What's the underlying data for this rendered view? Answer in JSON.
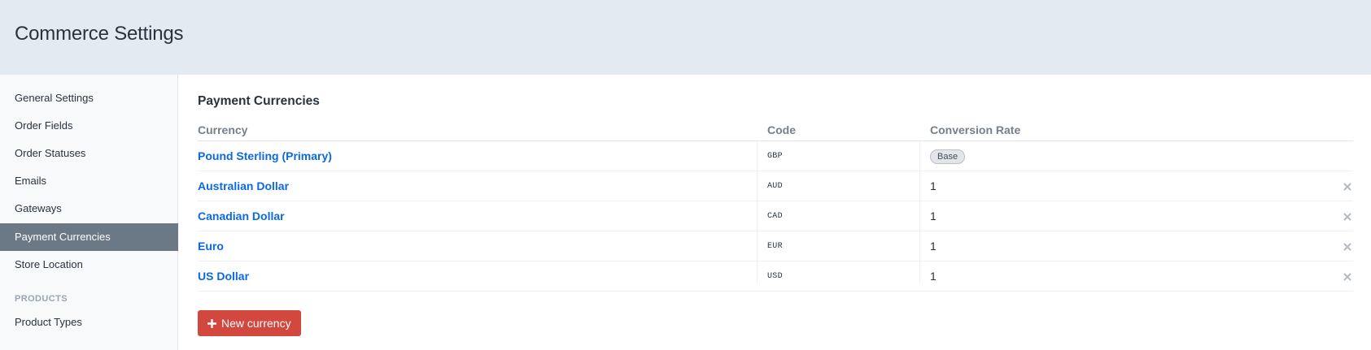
{
  "header": {
    "title": "Commerce Settings"
  },
  "sidebar": {
    "items": [
      {
        "label": "General Settings"
      },
      {
        "label": "Order Fields"
      },
      {
        "label": "Order Statuses"
      },
      {
        "label": "Emails"
      },
      {
        "label": "Gateways"
      },
      {
        "label": "Payment Currencies",
        "active": true
      },
      {
        "label": "Store Location"
      }
    ],
    "products_heading": "PRODUCTS",
    "product_items": [
      {
        "label": "Product Types"
      }
    ]
  },
  "main": {
    "section_title": "Payment Currencies",
    "columns": {
      "currency": "Currency",
      "code": "Code",
      "rate": "Conversion Rate"
    },
    "rows": [
      {
        "name": "Pound Sterling (Primary)",
        "code": "GBP",
        "rate": "Base"
      },
      {
        "name": "Australian Dollar",
        "code": "AUD",
        "rate": "1"
      },
      {
        "name": "Canadian Dollar",
        "code": "CAD",
        "rate": "1"
      },
      {
        "name": "Euro",
        "code": "EUR",
        "rate": "1"
      },
      {
        "name": "US Dollar",
        "code": "USD",
        "rate": "1"
      }
    ],
    "new_button_label": "New currency"
  },
  "colors": {
    "header_bg": "#e4eaf1",
    "active_nav_bg": "#6b7885",
    "link": "#0b69e3",
    "primary_button": "#d2473e"
  },
  "icons": {
    "delete": "x-icon",
    "add": "plus-icon"
  }
}
